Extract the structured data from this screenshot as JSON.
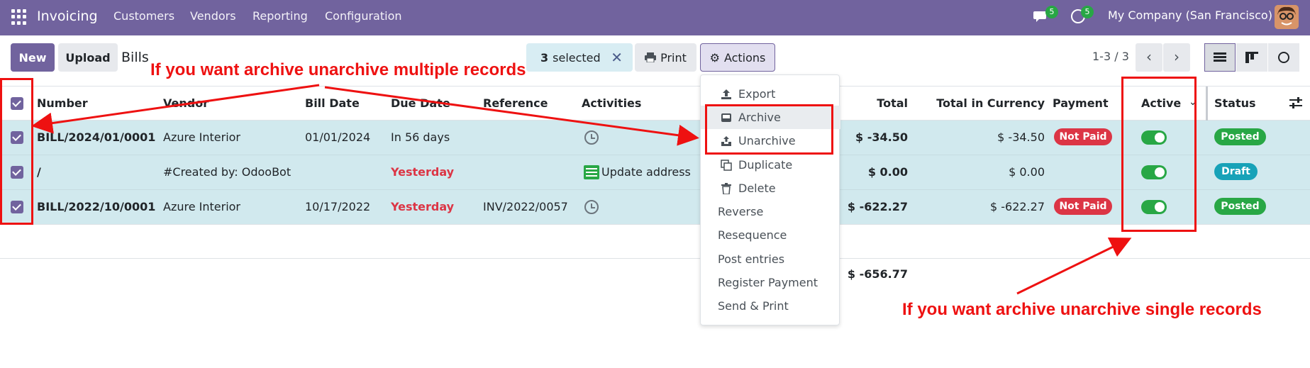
{
  "navbar": {
    "app_name": "Invoicing",
    "menu": [
      "Customers",
      "Vendors",
      "Reporting",
      "Configuration"
    ],
    "messages_count": "5",
    "activities_count": "5",
    "company": "My Company (San Francisco)"
  },
  "control": {
    "new_label": "New",
    "upload_label": "Upload",
    "title": "Bills",
    "selected_count": "3",
    "selected_label": "selected",
    "print_label": "Print",
    "actions_label": "Actions",
    "pager": "1-3 / 3"
  },
  "table": {
    "headers": {
      "number": "Number",
      "vendor": "Vendor",
      "bill_date": "Bill Date",
      "due_date": "Due Date",
      "reference": "Reference",
      "activities": "Activities",
      "total": "Total",
      "total_currency": "Total in Currency",
      "payment": "Payment",
      "active": "Active",
      "status": "Status"
    },
    "rows": [
      {
        "number": "BILL/2024/01/0001",
        "vendor": "Azure Interior",
        "bill_date": "01/01/2024",
        "due_date": "In 56 days",
        "reference": "",
        "activity": "",
        "total": "$ -34.50",
        "total_currency": "$ -34.50",
        "payment": "Not Paid",
        "status": "Posted"
      },
      {
        "number": "/",
        "vendor": "#Created by: OdooBot",
        "bill_date": "",
        "due_date": "Yesterday",
        "reference": "",
        "activity": "Update address",
        "total": "$ 0.00",
        "total_currency": "$ 0.00",
        "payment": "",
        "status": "Draft"
      },
      {
        "number": "BILL/2022/10/0001",
        "vendor": "Azure Interior",
        "bill_date": "10/17/2022",
        "due_date": "Yesterday",
        "reference": "INV/2022/0057",
        "activity": "",
        "total": "$ -622.27",
        "total_currency": "$ -622.27",
        "payment": "Not Paid",
        "status": "Posted"
      }
    ],
    "sum_total": "$ -656.77"
  },
  "actions_menu": {
    "items": [
      "Export",
      "Archive",
      "Unarchive",
      "Duplicate",
      "Delete",
      "Reverse",
      "Resequence",
      "Post entries",
      "Register Payment",
      "Send & Print"
    ]
  },
  "annotations": {
    "multiple": "If you want archive unarchive multiple records",
    "single": "If you want archive unarchive single records"
  },
  "colors": {
    "brand": "#71639e",
    "selected_row": "#d1e9ee",
    "annotation": "#ee1111",
    "posted": "#28a745",
    "draft": "#17a2b8",
    "not_paid": "#dc3545"
  }
}
